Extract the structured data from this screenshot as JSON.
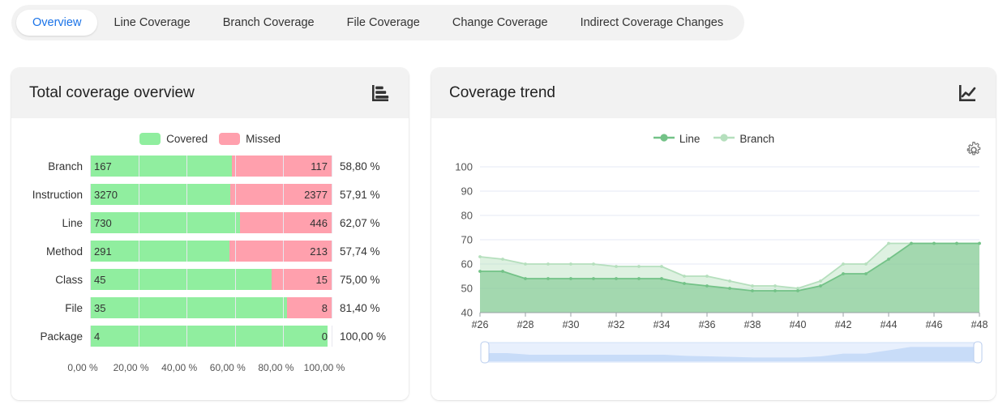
{
  "tabs": [
    {
      "label": "Overview",
      "active": true
    },
    {
      "label": "Line Coverage",
      "active": false
    },
    {
      "label": "Branch Coverage",
      "active": false
    },
    {
      "label": "File Coverage",
      "active": false
    },
    {
      "label": "Change Coverage",
      "active": false
    },
    {
      "label": "Indirect Coverage Changes",
      "active": false
    }
  ],
  "overview_card": {
    "title": "Total coverage overview",
    "icon": "bar-chart-icon",
    "legend": [
      {
        "label": "Covered",
        "color": "#90EE9F"
      },
      {
        "label": "Missed",
        "color": "#FFA0AD"
      }
    ]
  },
  "trend_card": {
    "title": "Coverage trend",
    "icon": "line-chart-icon",
    "settings_icon": "gear-icon",
    "legend": [
      {
        "label": "Line",
        "color": "#73C287"
      },
      {
        "label": "Branch",
        "color": "#B5DFBD"
      }
    ]
  },
  "chart_data": [
    {
      "type": "bar",
      "title": "Total coverage overview",
      "orientation": "horizontal",
      "stacked": true,
      "xlabel": "",
      "ylabel": "",
      "xlim": [
        0,
        100
      ],
      "grid": true,
      "tick_labels": [
        "0,00 %",
        "20,00 %",
        "40,00 %",
        "60,00 %",
        "80,00 %",
        "100,00 %"
      ],
      "tick_values": [
        0,
        20,
        40,
        60,
        80,
        100
      ],
      "categories": [
        "Branch",
        "Instruction",
        "Line",
        "Method",
        "Class",
        "File",
        "Package"
      ],
      "series": [
        {
          "name": "Covered",
          "color": "#90EE9F",
          "values": [
            167,
            3270,
            730,
            291,
            45,
            35,
            4
          ]
        },
        {
          "name": "Missed",
          "color": "#FFA0AD",
          "values": [
            117,
            2377,
            446,
            213,
            15,
            8,
            0
          ]
        }
      ],
      "rows": [
        {
          "category": "Branch",
          "covered": 167,
          "missed": 117,
          "percent": "58,80 %",
          "percent_value": 58.8
        },
        {
          "category": "Instruction",
          "covered": 3270,
          "missed": 2377,
          "percent": "57,91 %",
          "percent_value": 57.91
        },
        {
          "category": "Line",
          "covered": 730,
          "missed": 446,
          "percent": "62,07 %",
          "percent_value": 62.07
        },
        {
          "category": "Method",
          "covered": 291,
          "missed": 213,
          "percent": "57,74 %",
          "percent_value": 57.74
        },
        {
          "category": "Class",
          "covered": 45,
          "missed": 15,
          "percent": "75,00 %",
          "percent_value": 75.0
        },
        {
          "category": "File",
          "covered": 35,
          "missed": 8,
          "percent": "81,40 %",
          "percent_value": 81.4
        },
        {
          "category": "Package",
          "covered": 4,
          "missed": 0,
          "percent": "100,00 %",
          "percent_value": 100.0
        }
      ]
    },
    {
      "type": "area",
      "title": "Coverage trend",
      "xlabel": "",
      "ylabel": "",
      "ylim": [
        40,
        100
      ],
      "y_ticks": [
        40,
        50,
        60,
        70,
        80,
        90,
        100
      ],
      "grid": true,
      "legend_position": "top-center",
      "x": [
        "#26",
        "#27",
        "#28",
        "#29",
        "#30",
        "#31",
        "#32",
        "#33",
        "#34",
        "#35",
        "#36",
        "#37",
        "#38",
        "#39",
        "#40",
        "#41",
        "#42",
        "#43",
        "#44",
        "#45",
        "#46",
        "#47",
        "#48"
      ],
      "x_tick_labels": [
        "#26",
        "#28",
        "#30",
        "#32",
        "#34",
        "#36",
        "#38",
        "#40",
        "#42",
        "#44",
        "#46",
        "#48"
      ],
      "series": [
        {
          "name": "Line",
          "color": "#73C287",
          "values": [
            57,
            57,
            54,
            54,
            54,
            54,
            54,
            54,
            54,
            52,
            51,
            50,
            49,
            49,
            49,
            51,
            56,
            56,
            62,
            68.5,
            68.5,
            68.5,
            68.5
          ]
        },
        {
          "name": "Branch",
          "color": "#B5DFBD",
          "values": [
            63,
            62,
            60,
            60,
            60,
            60,
            59,
            59,
            59,
            55,
            55,
            53,
            51,
            51,
            50,
            53,
            60,
            60,
            68.5,
            68.5,
            68.5,
            68.5,
            68.5
          ]
        }
      ],
      "brush": {
        "visible": true,
        "range_start": "#26",
        "range_end": "#48",
        "color": "#cfe0f7"
      }
    }
  ]
}
